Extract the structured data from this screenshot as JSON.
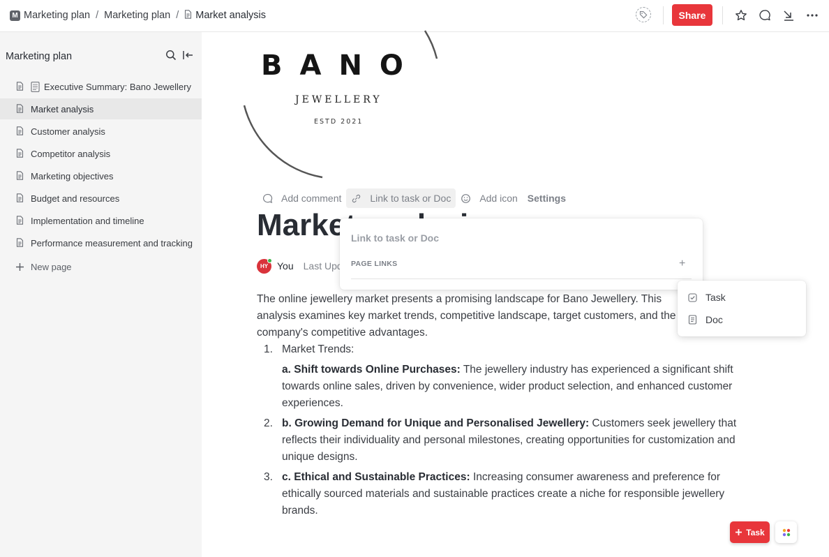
{
  "breadcrumb": {
    "workspace_initial": "M",
    "items": [
      "Marketing plan",
      "Marketing plan",
      "Market analysis"
    ]
  },
  "header": {
    "share_label": "Share"
  },
  "sidebar": {
    "title": "Marketing plan",
    "items": [
      {
        "label": "Executive Summary: Bano Jewellery"
      },
      {
        "label": "Market analysis"
      },
      {
        "label": "Customer analysis"
      },
      {
        "label": "Competitor analysis"
      },
      {
        "label": "Marketing objectives"
      },
      {
        "label": "Budget and resources"
      },
      {
        "label": "Implementation and timeline"
      },
      {
        "label": "Performance measurement and tracking"
      }
    ],
    "new_page_label": "New page"
  },
  "logo": {
    "brand": "BANO",
    "sub": "JEWELLERY",
    "estd": "ESTD 2021"
  },
  "doc_toolbar": {
    "add_comment": "Add comment",
    "link_task": "Link to task or Doc",
    "add_icon": "Add icon",
    "settings": "Settings"
  },
  "page": {
    "title": "Market analysis",
    "author_initials": "HY",
    "author": "You",
    "updated_label": "Last Upd",
    "intro": "The online jewellery market presents a promising landscape for Bano Jewellery. This analysis examines key market trends, competitive landscape, target customers, and the company's competitive advantages.",
    "list": [
      {
        "num": "1.",
        "text": "Market Trends:"
      },
      {
        "num": "",
        "bold": "a. Shift towards Online Purchases:",
        "text": " The jewellery industry has experienced a significant shift towards online sales, driven by convenience, wider product selection, and enhanced customer experiences."
      },
      {
        "num": "2.",
        "bold": "b. Growing Demand for Unique and Personalised Jewellery:",
        "text": " Customers seek jewellery that reflects their individuality and personal milestones, creating opportunities for customization and unique designs."
      },
      {
        "num": "3.",
        "bold": "c. Ethical and Sustainable Practices:",
        "text": " Increasing consumer awareness and preference for ethically sourced materials and sustainable practices create a niche for responsible jewellery brands."
      }
    ]
  },
  "link_popover": {
    "input_placeholder": "Link to task or Doc",
    "section_label": "PAGE LINKS",
    "plus": "+"
  },
  "link_dropdown": {
    "items": [
      "Task",
      "Doc"
    ]
  },
  "fab": {
    "task_label": "Task"
  },
  "colors": {
    "accent": "#e8363b",
    "sidebar_bg": "#f5f5f5",
    "active_item_bg": "#e8e8e8"
  }
}
